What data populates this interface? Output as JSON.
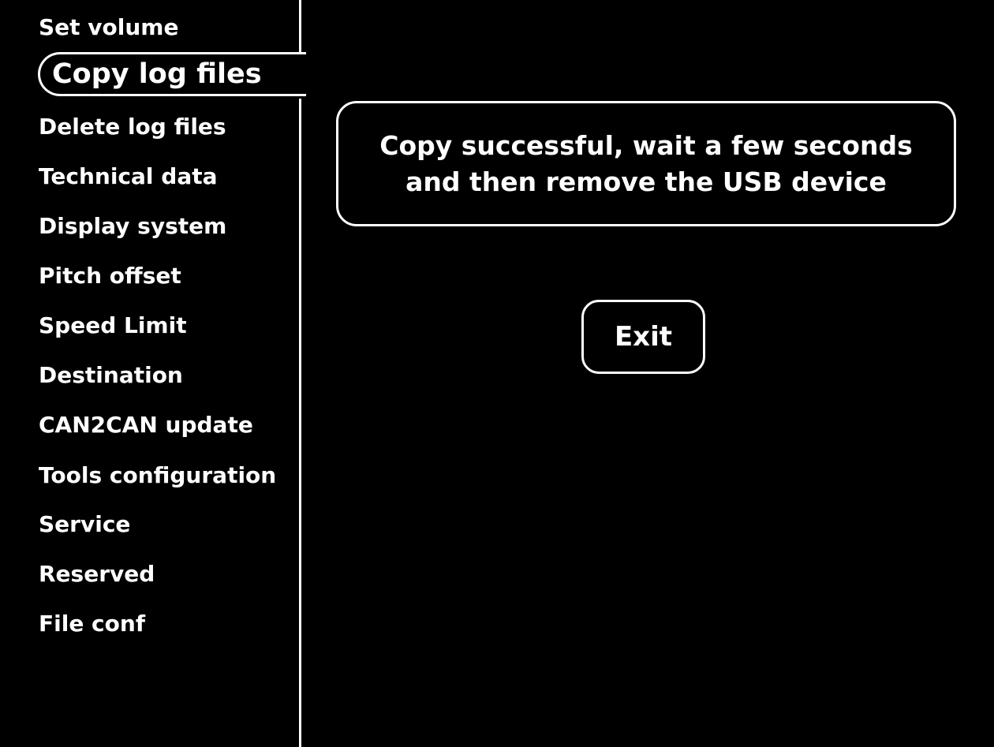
{
  "menu": {
    "items": [
      {
        "label": "Set volume"
      },
      {
        "label": "Copy log files",
        "selected": true
      },
      {
        "label": "Delete log files"
      },
      {
        "label": "Technical data"
      },
      {
        "label": "Display system"
      },
      {
        "label": "Pitch offset"
      },
      {
        "label": "Speed Limit"
      },
      {
        "label": "Destination"
      },
      {
        "label": "CAN2CAN update"
      },
      {
        "label": "Tools configuration"
      },
      {
        "label": "Service"
      },
      {
        "label": "Reserved"
      },
      {
        "label": "File conf"
      }
    ]
  },
  "message": {
    "line1": "Copy successful, wait a few seconds",
    "line2": "and then remove the USB device"
  },
  "exit_button": {
    "label": "Exit"
  },
  "colors": {
    "background": "#000000",
    "foreground": "#ffffff"
  }
}
